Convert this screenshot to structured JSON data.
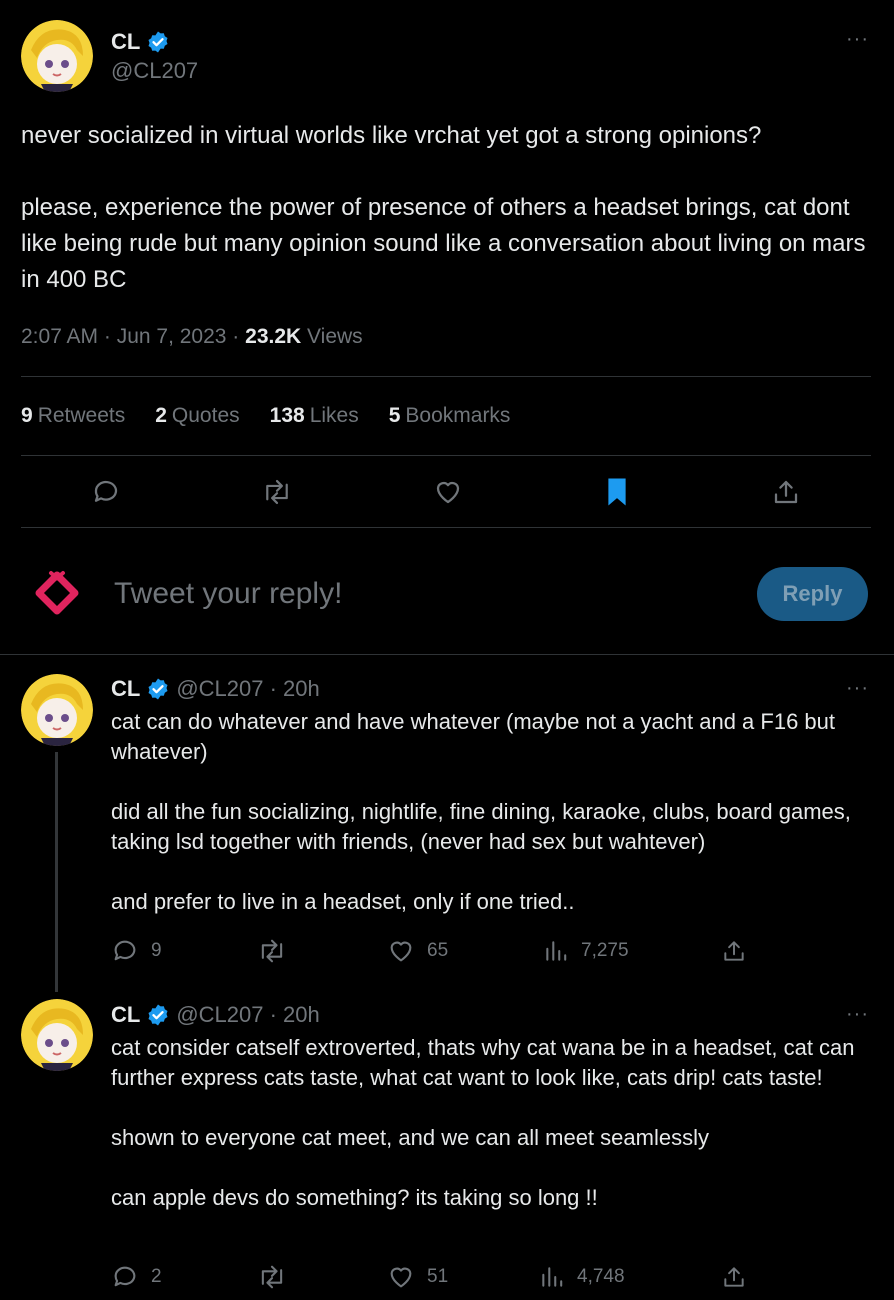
{
  "main_tweet": {
    "name": "CL",
    "handle": "@CL207",
    "text": "never socialized in virtual worlds like vrchat yet got a strong opinions?\n\nplease, experience the power of presence of others a headset brings, cat dont like being rude but many opinion sound like a conversation about living on mars in 400 BC",
    "time": "2:07 AM · Jun 7, 2023 · ",
    "views_count": "23.2K",
    "views_label": " Views",
    "stats": {
      "retweets_num": "9",
      "retweets_label": "Retweets",
      "quotes_num": "2",
      "quotes_label": "Quotes",
      "likes_num": "138",
      "likes_label": "Likes",
      "bookmarks_num": "5",
      "bookmarks_label": "Bookmarks"
    },
    "more_label": "···"
  },
  "composer": {
    "placeholder": "Tweet your reply!",
    "reply_label": "Reply"
  },
  "replies": [
    {
      "name": "CL",
      "handle": "@CL207 · 20h",
      "text": "cat can do whatever and have whatever (maybe not a yacht and a F16 but whatever)\n\ndid all the fun socializing, nightlife, fine dining, karaoke, clubs, board games, taking lsd together with friends, (never had sex but wahtever)\n\nand prefer to live in a headset, only if one tried..",
      "replies": "9",
      "retweets": "",
      "likes": "65",
      "views": "7,275",
      "more_label": "···"
    },
    {
      "name": "CL",
      "handle": "@CL207 · 20h",
      "text": "cat consider catself extroverted, thats why cat wana be in a headset, cat can further express cats taste, what cat want to look like, cats drip! cats taste!\n\nshown to everyone cat meet, and we can all meet seamlessly\n\ncan apple devs do something? its taking so long !!",
      "replies": "2",
      "retweets": "",
      "likes": "51",
      "views": "4,748",
      "more_label": "···"
    }
  ],
  "colors": {
    "background": "#000000",
    "text": "#e7e9ea",
    "muted": "#71767b",
    "verified": "#1d9bf0",
    "bookmark_active": "#1d9bf0",
    "reply_button": "#1a5a86",
    "composer_logo": "#e0245e"
  }
}
